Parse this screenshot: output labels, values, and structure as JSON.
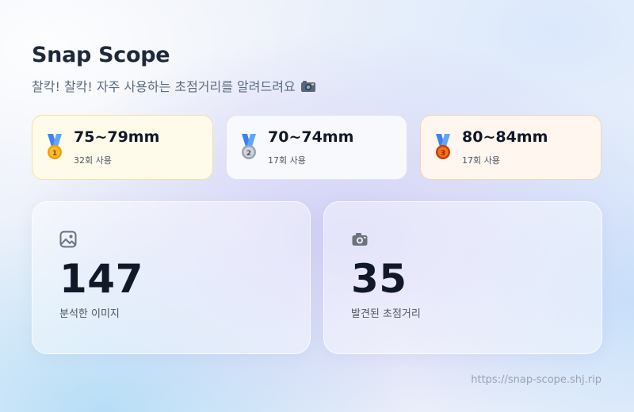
{
  "header": {
    "title": "Snap Scope",
    "subtitle": "찰칵! 찰칵! 자주 사용하는 초점거리를 알려드려요"
  },
  "icons": {
    "subtitle_emoji": "camera-with-flash-icon",
    "first_medal": "first-place-medal-icon",
    "second_medal": "second-place-medal-icon",
    "third_medal": "third-place-medal-icon",
    "images_stat": "image-icon",
    "focal_stat": "camera-icon"
  },
  "rankings": [
    {
      "range": "75~79mm",
      "count": "32회 사용"
    },
    {
      "range": "70~74mm",
      "count": "17회 사용"
    },
    {
      "range": "80~84mm",
      "count": "17회 사용"
    }
  ],
  "stats": [
    {
      "value": "147",
      "label": "분석한 이미지"
    },
    {
      "value": "35",
      "label": "발견된 초점거리"
    }
  ],
  "footer": {
    "link": "https://snap-scope.shj.rip"
  },
  "colors": {
    "gold_card_bg": "#fefbea",
    "silver_card_bg": "#f8f9fc",
    "bronze_card_bg": "#fef6ef",
    "text_primary": "#111827",
    "text_muted": "#5b6b80"
  }
}
